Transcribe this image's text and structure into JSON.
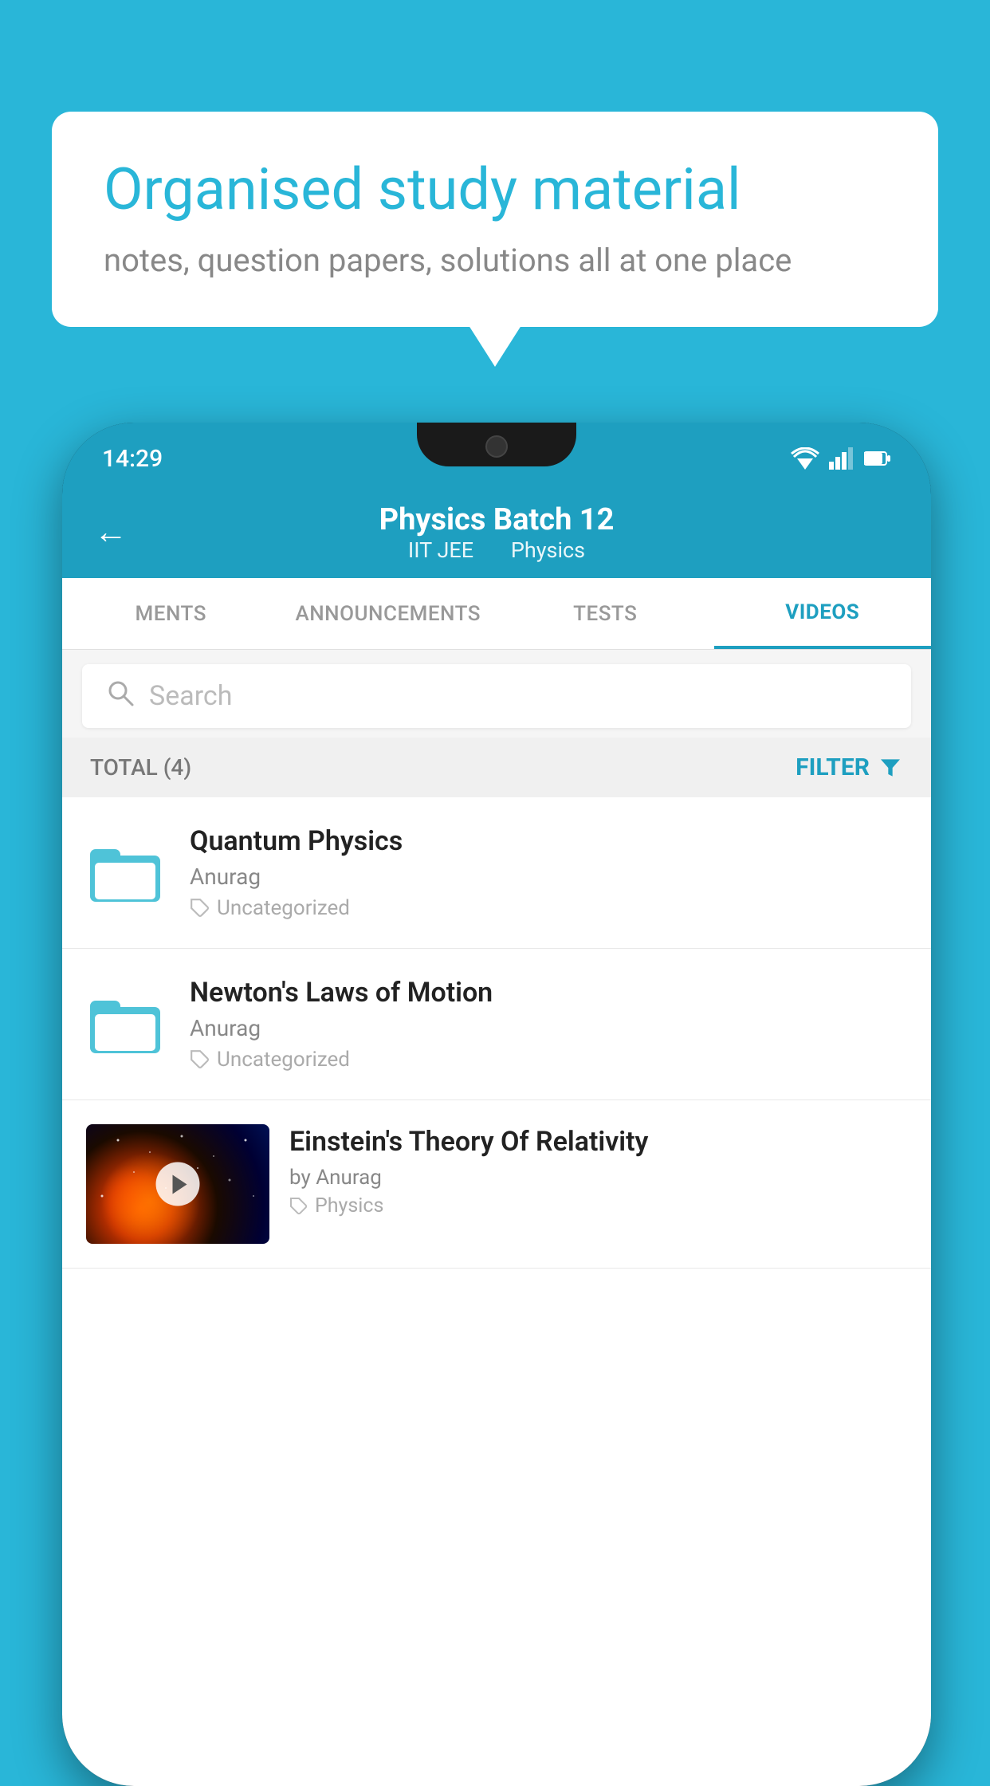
{
  "background_color": "#29b6d8",
  "speech_bubble": {
    "title": "Organised study material",
    "subtitle": "notes, question papers, solutions all at one place"
  },
  "status_bar": {
    "time": "14:29",
    "wifi": "▼",
    "signal": "▲",
    "battery": "▌"
  },
  "header": {
    "back_label": "←",
    "title": "Physics Batch 12",
    "subtitle_left": "IIT JEE",
    "subtitle_right": "Physics"
  },
  "tabs": [
    {
      "label": "MENTS",
      "active": false
    },
    {
      "label": "ANNOUNCEMENTS",
      "active": false
    },
    {
      "label": "TESTS",
      "active": false
    },
    {
      "label": "VIDEOS",
      "active": true
    }
  ],
  "search": {
    "placeholder": "Search"
  },
  "filter_bar": {
    "total_label": "TOTAL (4)",
    "filter_label": "FILTER"
  },
  "videos": [
    {
      "id": 1,
      "title": "Quantum Physics",
      "author": "Anurag",
      "tag": "Uncategorized",
      "type": "folder"
    },
    {
      "id": 2,
      "title": "Newton's Laws of Motion",
      "author": "Anurag",
      "tag": "Uncategorized",
      "type": "folder"
    },
    {
      "id": 3,
      "title": "Einstein's Theory Of Relativity",
      "author": "by Anurag",
      "tag": "Physics",
      "type": "thumbnail"
    }
  ]
}
